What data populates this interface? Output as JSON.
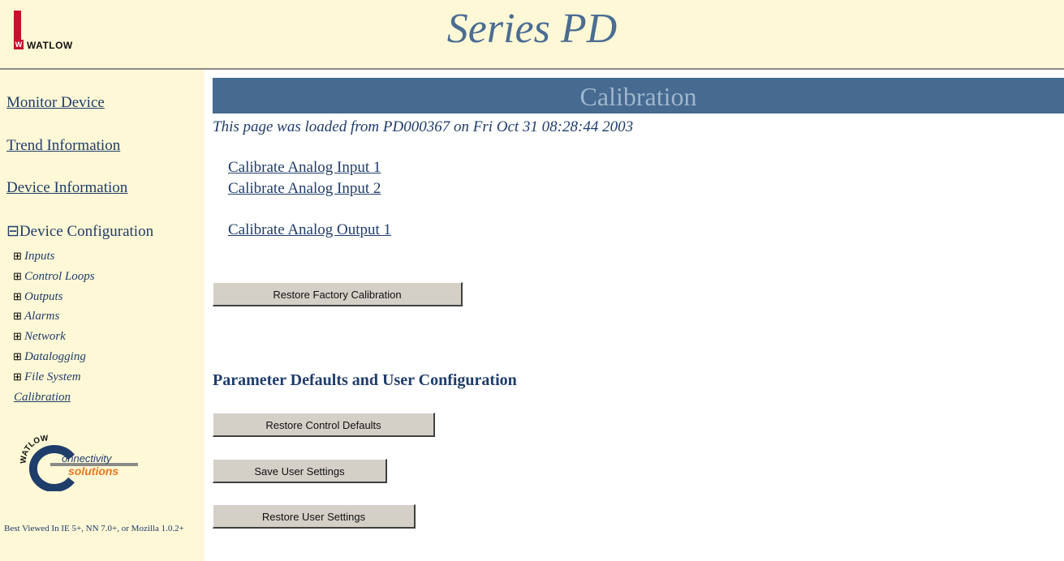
{
  "header": {
    "brand": "WATLOW",
    "brand_mark": "W",
    "title": "Series PD"
  },
  "sidebar": {
    "links": [
      "Monitor Device",
      "Trend Information",
      "Device Information"
    ],
    "tree_root": {
      "toggle": "⊟",
      "label": "Device Configuration"
    },
    "tree_items": [
      {
        "toggle": "⊞",
        "label": "Inputs"
      },
      {
        "toggle": "⊞",
        "label": "Control Loops"
      },
      {
        "toggle": "⊞",
        "label": "Outputs"
      },
      {
        "toggle": "⊞",
        "label": "Alarms"
      },
      {
        "toggle": "⊞",
        "label": "Network"
      },
      {
        "toggle": "⊞",
        "label": "Datalogging"
      },
      {
        "toggle": "⊞",
        "label": "File System"
      }
    ],
    "calibration_link": "Calibration",
    "badge": {
      "arc": "WATLOW",
      "letter": "C",
      "line1": "onnectivity",
      "line2": "solutions"
    },
    "footnote": "Best Viewed In IE 5+, NN 7.0+, or Mozilla 1.0.2+"
  },
  "main": {
    "section_title": "Calibration",
    "loaded_text": "This page was loaded from PD000367 on Fri Oct 31 08:28:44 2003",
    "links": [
      "Calibrate Analog Input 1",
      "Calibrate Analog Input 2",
      "Calibrate Analog Output 1"
    ],
    "restore_factory_button": "Restore Factory Calibration",
    "defaults_heading": "Parameter Defaults and User Configuration",
    "restore_defaults_button": "Restore Control Defaults",
    "save_user_button": "Save User Settings",
    "restore_user_button": "Restore User Settings"
  },
  "colors": {
    "header_bg": "#fff8d6",
    "title_color": "#4b6d93",
    "section_bar": "#466a90",
    "link_color": "#1f3d6b",
    "brand_red": "#c8102e",
    "button_face": "#d4d0c8"
  }
}
